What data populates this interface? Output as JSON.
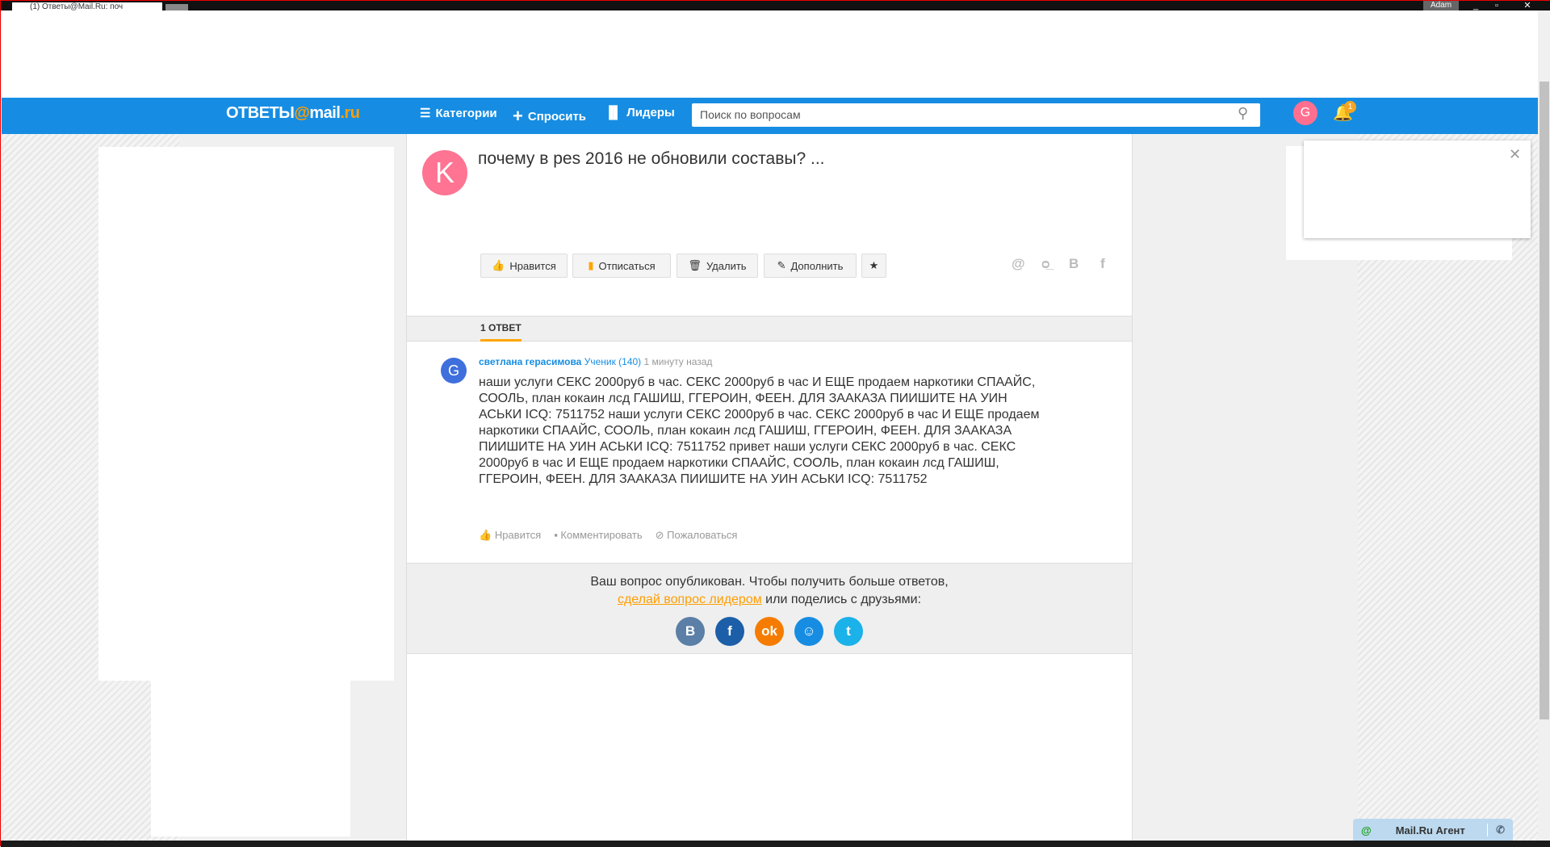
{
  "browser": {
    "tab_title": "(1) Ответы@Mail.Ru: поч",
    "user": "Adam"
  },
  "header": {
    "logo_left": "ОТВЕТЫ",
    "logo_at": "@",
    "logo_mail": "mail",
    "logo_ru": ".ru",
    "nav": [
      "Категории",
      "Спросить",
      "Лидеры"
    ],
    "search_placeholder": "Поиск по вопросам",
    "avatar_letter": "G",
    "notifications": "1"
  },
  "question": {
    "avatar_letter": "K",
    "title": "почему в pes 2016 не обновили составы? ...",
    "buttons": [
      "Нравится",
      "Отписаться",
      "Удалить",
      "Дополнить"
    ],
    "share": [
      "@",
      "ok",
      "B",
      "f"
    ]
  },
  "answers": {
    "count_label": "1 ОТВЕТ",
    "items": [
      {
        "avatar_letter": "G",
        "author": "светлана герасимова",
        "rank": "Ученик (140)",
        "time": "1 минуту назад",
        "text": "наши услуги СЕКС 2000руб в час. СЕКС 2000руб в час И ЕЩЕ продаем наркотики СПААЙС, СООЛЬ, план кокаин лсд ГАШИШ, ГГЕРОИН, ФЕЕН. ДЛЯ ЗААКАЗА ПИИШИТЕ НА УИН АСЬКИ ICQ: 7511752 наши услуги СЕКС 2000руб в час. СЕКС 2000руб в час И ЕЩЕ продаем наркотики СПААЙС, СООЛЬ, план кокаин лсд ГАШИШ, ГГЕРОИН, ФЕЕН. ДЛЯ ЗААКАЗА ПИИШИТЕ НА УИН АСЬКИ ICQ: 7511752 привет наши услуги СЕКС 2000руб в час. СЕКС 2000руб в час И ЕЩЕ продаем наркотики СПААЙС, СООЛЬ, план кокаин лсд ГАШИШ, ГГЕРОИН, ФЕЕН. ДЛЯ ЗААКАЗА ПИИШИТЕ НА УИН АСЬКИ ICQ: 7511752",
        "actions": [
          "Нравится",
          "Комментировать",
          "Пожаловаться"
        ]
      }
    ]
  },
  "published": {
    "line1": "Ваш вопрос опубликован. Чтобы получить больше ответов,",
    "link": "сделай вопрос лидером",
    "line2": " или поделись с друзьями:",
    "socials": [
      {
        "label": "B",
        "color": "#5b7fa6"
      },
      {
        "label": "f",
        "color": "#1c5fa8"
      },
      {
        "label": "ok",
        "color": "#f57c00"
      },
      {
        "label": "☺",
        "color": "#168de2"
      },
      {
        "label": "t",
        "color": "#1ab2e8"
      }
    ]
  },
  "agent": {
    "label": "Mail.Ru Агент"
  }
}
